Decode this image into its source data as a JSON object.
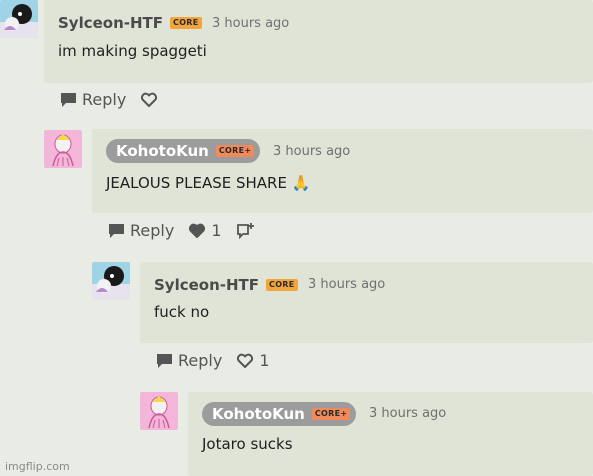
{
  "comments": [
    {
      "username": "Sylceon-HTF",
      "badge": "CORE",
      "time": "3 hours ago",
      "text": "im making spaggeti",
      "reply_label": "Reply",
      "like_count": ""
    },
    {
      "username": "KohotoKun",
      "badge": "CORE+",
      "time": "3 hours ago",
      "text": "JEALOUS PLEASE SHARE 🙏",
      "reply_label": "Reply",
      "like_count": "1"
    },
    {
      "username": "Sylceon-HTF",
      "badge": "CORE",
      "time": "3 hours ago",
      "text": "fuck no",
      "reply_label": "Reply",
      "like_count": "1"
    },
    {
      "username": "KohotoKun",
      "badge": "CORE+",
      "time": "3 hours ago",
      "text": "Jotaro sucks"
    }
  ],
  "watermark": "imgflip.com",
  "colors": {
    "bubble": "#dfe4d7",
    "page": "#e8ece4",
    "core_badge": "#f3a53b",
    "coreplus_badge": "#f08a5a",
    "highlight_pill": "#9c9c9c"
  },
  "icons": {
    "reply": "speech-bubble-icon",
    "like": "heart-icon",
    "add_image": "add-image-icon"
  }
}
